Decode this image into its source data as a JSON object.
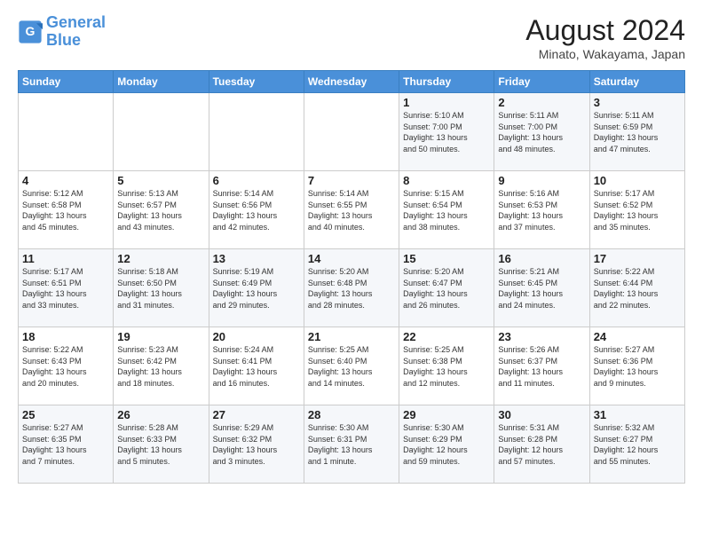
{
  "header": {
    "logo_line1": "General",
    "logo_line2": "Blue",
    "title": "August 2024",
    "location": "Minato, Wakayama, Japan"
  },
  "days_of_week": [
    "Sunday",
    "Monday",
    "Tuesday",
    "Wednesday",
    "Thursday",
    "Friday",
    "Saturday"
  ],
  "weeks": [
    [
      {
        "day": "",
        "info": ""
      },
      {
        "day": "",
        "info": ""
      },
      {
        "day": "",
        "info": ""
      },
      {
        "day": "",
        "info": ""
      },
      {
        "day": "1",
        "info": "Sunrise: 5:10 AM\nSunset: 7:00 PM\nDaylight: 13 hours\nand 50 minutes."
      },
      {
        "day": "2",
        "info": "Sunrise: 5:11 AM\nSunset: 7:00 PM\nDaylight: 13 hours\nand 48 minutes."
      },
      {
        "day": "3",
        "info": "Sunrise: 5:11 AM\nSunset: 6:59 PM\nDaylight: 13 hours\nand 47 minutes."
      }
    ],
    [
      {
        "day": "4",
        "info": "Sunrise: 5:12 AM\nSunset: 6:58 PM\nDaylight: 13 hours\nand 45 minutes."
      },
      {
        "day": "5",
        "info": "Sunrise: 5:13 AM\nSunset: 6:57 PM\nDaylight: 13 hours\nand 43 minutes."
      },
      {
        "day": "6",
        "info": "Sunrise: 5:14 AM\nSunset: 6:56 PM\nDaylight: 13 hours\nand 42 minutes."
      },
      {
        "day": "7",
        "info": "Sunrise: 5:14 AM\nSunset: 6:55 PM\nDaylight: 13 hours\nand 40 minutes."
      },
      {
        "day": "8",
        "info": "Sunrise: 5:15 AM\nSunset: 6:54 PM\nDaylight: 13 hours\nand 38 minutes."
      },
      {
        "day": "9",
        "info": "Sunrise: 5:16 AM\nSunset: 6:53 PM\nDaylight: 13 hours\nand 37 minutes."
      },
      {
        "day": "10",
        "info": "Sunrise: 5:17 AM\nSunset: 6:52 PM\nDaylight: 13 hours\nand 35 minutes."
      }
    ],
    [
      {
        "day": "11",
        "info": "Sunrise: 5:17 AM\nSunset: 6:51 PM\nDaylight: 13 hours\nand 33 minutes."
      },
      {
        "day": "12",
        "info": "Sunrise: 5:18 AM\nSunset: 6:50 PM\nDaylight: 13 hours\nand 31 minutes."
      },
      {
        "day": "13",
        "info": "Sunrise: 5:19 AM\nSunset: 6:49 PM\nDaylight: 13 hours\nand 29 minutes."
      },
      {
        "day": "14",
        "info": "Sunrise: 5:20 AM\nSunset: 6:48 PM\nDaylight: 13 hours\nand 28 minutes."
      },
      {
        "day": "15",
        "info": "Sunrise: 5:20 AM\nSunset: 6:47 PM\nDaylight: 13 hours\nand 26 minutes."
      },
      {
        "day": "16",
        "info": "Sunrise: 5:21 AM\nSunset: 6:45 PM\nDaylight: 13 hours\nand 24 minutes."
      },
      {
        "day": "17",
        "info": "Sunrise: 5:22 AM\nSunset: 6:44 PM\nDaylight: 13 hours\nand 22 minutes."
      }
    ],
    [
      {
        "day": "18",
        "info": "Sunrise: 5:22 AM\nSunset: 6:43 PM\nDaylight: 13 hours\nand 20 minutes."
      },
      {
        "day": "19",
        "info": "Sunrise: 5:23 AM\nSunset: 6:42 PM\nDaylight: 13 hours\nand 18 minutes."
      },
      {
        "day": "20",
        "info": "Sunrise: 5:24 AM\nSunset: 6:41 PM\nDaylight: 13 hours\nand 16 minutes."
      },
      {
        "day": "21",
        "info": "Sunrise: 5:25 AM\nSunset: 6:40 PM\nDaylight: 13 hours\nand 14 minutes."
      },
      {
        "day": "22",
        "info": "Sunrise: 5:25 AM\nSunset: 6:38 PM\nDaylight: 13 hours\nand 12 minutes."
      },
      {
        "day": "23",
        "info": "Sunrise: 5:26 AM\nSunset: 6:37 PM\nDaylight: 13 hours\nand 11 minutes."
      },
      {
        "day": "24",
        "info": "Sunrise: 5:27 AM\nSunset: 6:36 PM\nDaylight: 13 hours\nand 9 minutes."
      }
    ],
    [
      {
        "day": "25",
        "info": "Sunrise: 5:27 AM\nSunset: 6:35 PM\nDaylight: 13 hours\nand 7 minutes."
      },
      {
        "day": "26",
        "info": "Sunrise: 5:28 AM\nSunset: 6:33 PM\nDaylight: 13 hours\nand 5 minutes."
      },
      {
        "day": "27",
        "info": "Sunrise: 5:29 AM\nSunset: 6:32 PM\nDaylight: 13 hours\nand 3 minutes."
      },
      {
        "day": "28",
        "info": "Sunrise: 5:30 AM\nSunset: 6:31 PM\nDaylight: 13 hours\nand 1 minute."
      },
      {
        "day": "29",
        "info": "Sunrise: 5:30 AM\nSunset: 6:29 PM\nDaylight: 12 hours\nand 59 minutes."
      },
      {
        "day": "30",
        "info": "Sunrise: 5:31 AM\nSunset: 6:28 PM\nDaylight: 12 hours\nand 57 minutes."
      },
      {
        "day": "31",
        "info": "Sunrise: 5:32 AM\nSunset: 6:27 PM\nDaylight: 12 hours\nand 55 minutes."
      }
    ]
  ]
}
